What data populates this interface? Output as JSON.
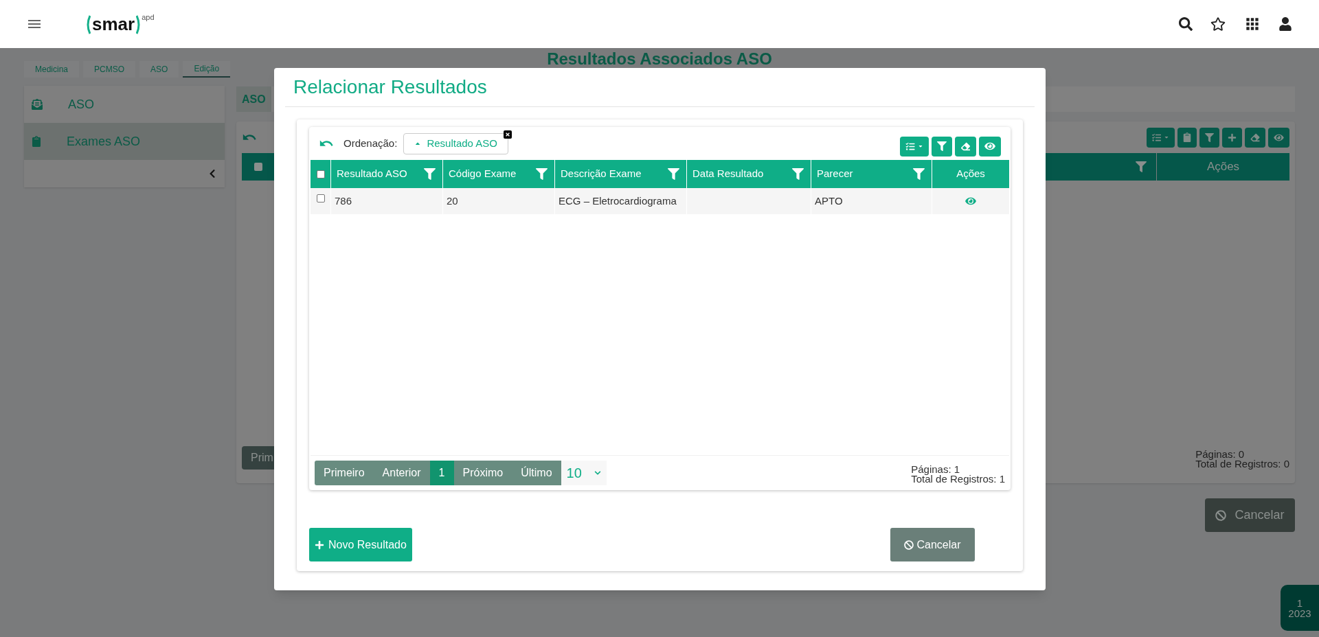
{
  "header": {
    "logo": {
      "name": "smar",
      "suffix": "apd"
    }
  },
  "breadcrumb": [
    {
      "label": "Medicina",
      "selected": false
    },
    {
      "label": "PCMSO",
      "selected": false
    },
    {
      "label": "ASO",
      "selected": false
    },
    {
      "label": "Edição",
      "selected": true
    }
  ],
  "page_title": "Resultados Associados ASO",
  "sidebar": {
    "items": [
      {
        "label": "ASO",
        "kind": "envelope",
        "selected": false
      },
      {
        "label": "Exames ASO",
        "kind": "clipboard",
        "selected": true
      }
    ]
  },
  "main": {
    "tab": "ASO",
    "grid": {
      "select_all": {
        "checked": false
      },
      "last_column": "Ações",
      "pagination_first": "Prim",
      "pages": "Páginas: 0",
      "total": "Total de Registros: 0"
    },
    "cancel": "Cancelar"
  },
  "year_badge": {
    "month": "1",
    "year": "2023"
  },
  "modal": {
    "title": "Relacionar Resultados",
    "sort": {
      "label": "Ordenação:",
      "field": "Resultado ASO",
      "ascending": true
    },
    "columns": [
      {
        "label": "Resultado ASO",
        "filter": true
      },
      {
        "label": "Código Exame",
        "filter": true
      },
      {
        "label": "Descrição Exame",
        "filter": true
      },
      {
        "label": "Data Resultado",
        "filter": true
      },
      {
        "label": "Parecer",
        "filter": true
      },
      {
        "label": "Ações",
        "filter": false
      }
    ],
    "select_all": {
      "checked": false
    },
    "rows": [
      {
        "checked": false,
        "cells": [
          "786",
          "20",
          "ECG – Eletrocardiograma",
          null,
          "APTO"
        ]
      }
    ],
    "pagination": {
      "before": [
        "Primeiro",
        "Anterior"
      ],
      "pages": [
        {
          "label": "1",
          "selected": true
        }
      ],
      "after": [
        "Próximo",
        "Último"
      ],
      "page_size": "10",
      "pages_info": "Páginas: 1",
      "total": "Total de Registros: 1"
    },
    "buttons": [
      {
        "kind": "add",
        "label": "Novo Resultado"
      },
      {
        "kind": "cancel",
        "label": "Cancelar"
      }
    ]
  }
}
